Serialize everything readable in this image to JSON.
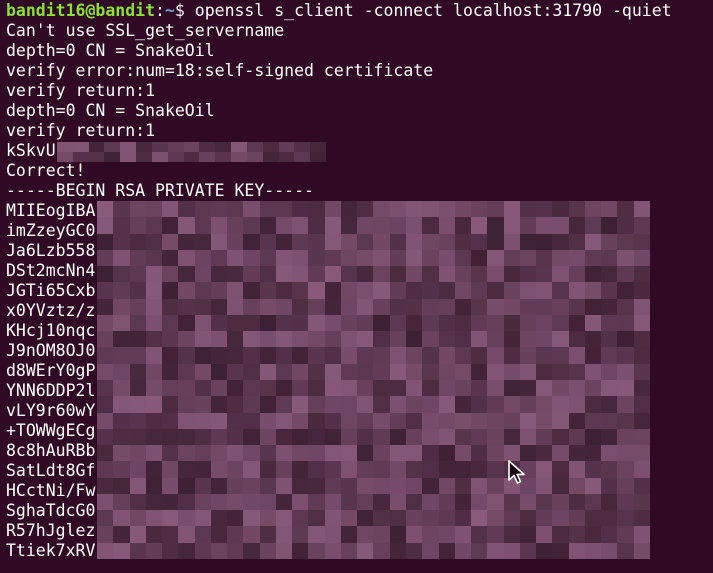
{
  "terminal": {
    "prompt": {
      "user_host": "bandit16@bandit",
      "separator": ":",
      "path": "~",
      "symbol": "$ ",
      "command": "openssl s_client -connect localhost:31790 -quiet"
    },
    "output": [
      "Can't use SSL_get_servername",
      "depth=0 CN = SnakeOil",
      "verify error:num=18:self-signed certificate",
      "verify return:1",
      "depth=0 CN = SnakeOil",
      "verify return:1"
    ],
    "password_prefix": "kSkvU",
    "result": "Correct!",
    "key_header": "-----BEGIN RSA PRIVATE KEY-----",
    "key_lines": [
      "MIIEogIBA",
      "imZzeyGC0",
      "Ja6Lzb558",
      "DSt2mcNn4",
      "JGTi65Cxb",
      "x0YVztz/z",
      "KHcj10nqc",
      "J9nOM8OJ0",
      "d8WErY0gP",
      "YNN6DDP2l",
      "vLY9r60wY",
      "+TOWWgECg",
      "8c8hAuRBb",
      "SatLdt8Gf",
      "HCctNi/Fw",
      "SghaTdcG0",
      "R57hJglez",
      "Ttiek7xRV"
    ],
    "colors": {
      "background": "#300a24",
      "text": "#ffffff",
      "prompt_user": "#8ae234",
      "prompt_path": "#729fcf",
      "redaction_base": "#6b4a62"
    },
    "icons": {
      "pointer": "mouse-pointer-icon"
    }
  }
}
